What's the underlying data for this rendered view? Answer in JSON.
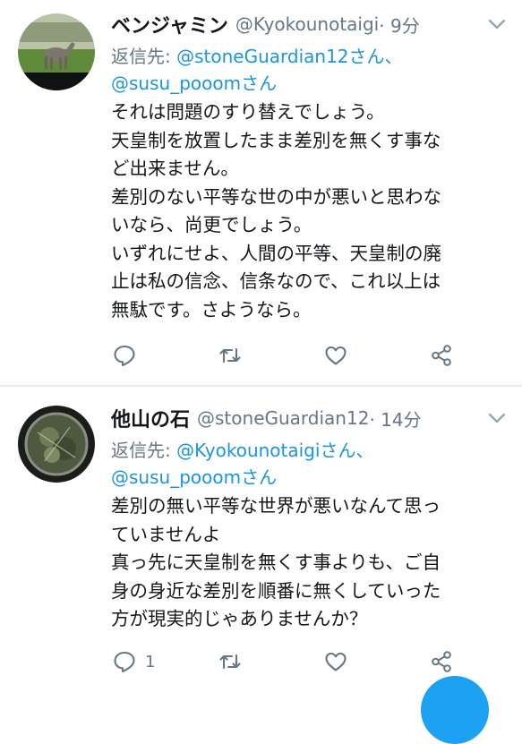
{
  "tweets": [
    {
      "name": "ベンジャミン",
      "handle": "@Kyokounotaigi",
      "time": "· 9分",
      "reply_prefix": "返信先: ",
      "mention1": "@stoneGuardian12さん、",
      "mention2": "@susu_pooomさん",
      "lines": [
        "それは問題のすり替えでしょう。",
        "天皇制を放置したまま差別を無くす事な",
        "ど出来ません。",
        "差別のない平等な世の中が悪いと思わな",
        "いなら、尚更でしょう。",
        "いずれにせよ、人間の平等、天皇制の廃",
        "止は私の信念、信条なので、これ以上は",
        "無駄です。さようなら。"
      ],
      "reply_count": ""
    },
    {
      "name": "他山の石",
      "handle": "@stoneGuardian12",
      "time": "· 14分",
      "reply_prefix": "返信先: ",
      "mention1": "@Kyokounotaigiさん、",
      "mention2": "@susu_pooomさん",
      "lines": [
        "差別の無い平等な世界が悪いなんて思っ",
        "ていませんよ",
        "真っ先に天皇制を無くす事よりも、ご自",
        "身の身近な差別を順番に無くしていった",
        "方が現実的じゃありませんか？"
      ],
      "reply_count": "1"
    }
  ],
  "colors": {
    "text": "#14171a",
    "secondary": "#657786",
    "link": "#1b95e0",
    "divider": "#e6ecf0",
    "fab": "#1da1f2"
  },
  "icons": [
    "chevron-down-icon",
    "reply-icon",
    "retweet-icon",
    "like-icon",
    "share-icon"
  ]
}
